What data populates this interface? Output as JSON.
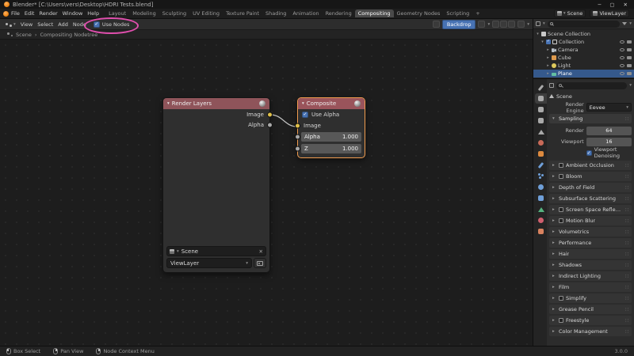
{
  "titlebar": {
    "title": "Blender* [C:\\Users\\vers\\Desktop\\HDRI Tests.blend]"
  },
  "window_controls": {
    "minimize": "─",
    "maximize": "▢",
    "close": "✕"
  },
  "glyphs": {
    "check": "✓",
    "caret_down": "▾",
    "caret_right": "▸",
    "close": "✕",
    "dots": "∷",
    "separator": "›",
    "plus": "+"
  },
  "menubar": {
    "menus": [
      "File",
      "Edit",
      "Render",
      "Window",
      "Help"
    ],
    "workspaces": [
      "Layout",
      "Modeling",
      "Sculpting",
      "UV Editing",
      "Texture Paint",
      "Shading",
      "Animation",
      "Rendering",
      "Compositing",
      "Geometry Nodes",
      "Scripting"
    ],
    "scene": "Scene",
    "view_layer": "ViewLayer"
  },
  "compositor": {
    "menus": [
      "View",
      "Select",
      "Add",
      "Node"
    ],
    "use_nodes": "Use Nodes",
    "backdrop": "Backdrop",
    "breadcrumb": [
      "Scene",
      "Compositing Nodetree"
    ]
  },
  "nodes": {
    "render_layers": {
      "title": "Render Layers",
      "outputs": [
        "Image",
        "Alpha"
      ],
      "scene": "Scene",
      "view_layer": "ViewLayer"
    },
    "composite": {
      "title": "Composite",
      "use_alpha": "Use Alpha",
      "image_input": "Image",
      "alpha_label": "Alpha",
      "alpha_value": "1.000",
      "z_label": "Z",
      "z_value": "1.000"
    }
  },
  "outliner": {
    "scene_collection": "Scene Collection",
    "collection": "Collection",
    "objects": [
      "Camera",
      "Cube",
      "Light",
      "Plane"
    ]
  },
  "properties": {
    "breadcrumb": "Scene",
    "render_engine_label": "Render Engine",
    "render_engine": "Eevee",
    "sampling": {
      "title": "Sampling",
      "render_label": "Render",
      "render_value": "64",
      "viewport_label": "Viewport",
      "viewport_value": "16",
      "denoising_label": "Viewport Denoising"
    },
    "sections": [
      "Ambient Occlusion",
      "Bloom",
      "Depth of Field",
      "Subsurface Scattering",
      "Screen Space Reflections",
      "Motion Blur",
      "Volumetrics",
      "Performance",
      "Hair",
      "Shadows",
      "Indirect Lighting",
      "Film",
      "Simplify",
      "Grease Pencil",
      "Freestyle",
      "Color Management"
    ]
  },
  "statusbar": {
    "items": [
      "Box Select",
      "Pan View",
      "Node Context Menu"
    ],
    "version": "3.0.0"
  },
  "colors": {
    "accent_blue": "#4772b3",
    "selection_orange": "#f09c4f",
    "node_header_red": "#8f545a",
    "annotation_pink": "#e14fae",
    "socket_yellow": "#e0c14a",
    "socket_gray": "#a8a8a8"
  }
}
